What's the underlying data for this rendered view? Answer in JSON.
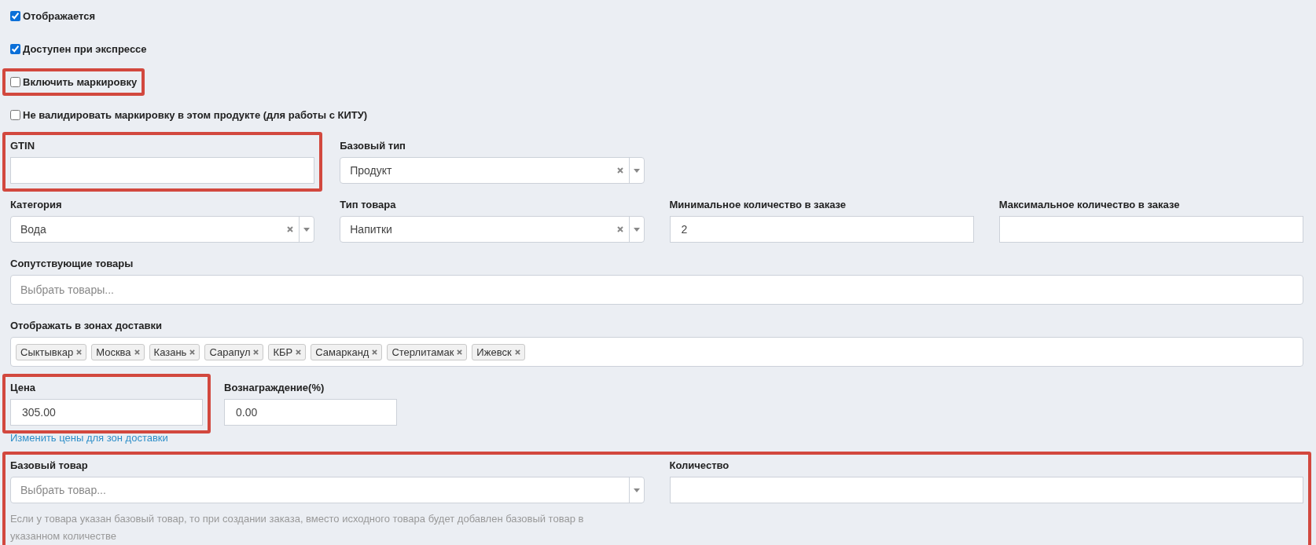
{
  "checkboxes": [
    {
      "label": "Отображается",
      "checked": true,
      "highlighted": false
    },
    {
      "label": "Доступен при экспрессе",
      "checked": true,
      "highlighted": false
    },
    {
      "label": "Включить маркировку",
      "checked": false,
      "highlighted": true
    },
    {
      "label": "Не валидировать маркировку в этом продукте (для работы с КИТУ)",
      "checked": false,
      "highlighted": false
    }
  ],
  "rows": [
    {
      "kind": "quad",
      "highlighted": false,
      "fields": [
        {
          "kind": "input",
          "label": "GTIN",
          "highlighted": true
        },
        {
          "kind": "select",
          "label": "Базовый тип",
          "value": "Продукт",
          "clearable": true,
          "highlighted": false
        }
      ]
    },
    {
      "kind": "quad",
      "highlighted": false,
      "fields": [
        {
          "kind": "select",
          "label": "Категория",
          "value": "Вода",
          "clearable": true,
          "highlighted": false
        },
        {
          "kind": "select",
          "label": "Тип товара",
          "value": "Напитки",
          "clearable": true,
          "highlighted": false
        },
        {
          "kind": "input",
          "label": "Минимальное количество в заказе",
          "value": "2",
          "highlighted": false
        },
        {
          "kind": "input",
          "label": "Максимальное количество в заказе",
          "highlighted": false
        }
      ]
    },
    {
      "kind": "wide",
      "highlighted": false,
      "fields": [
        {
          "kind": "multiselect",
          "label": "Сопутствующие товары",
          "placeholder": "Выбрать товары...",
          "highlighted": false
        }
      ]
    },
    {
      "kind": "wide",
      "highlighted": false,
      "fields": [
        {
          "kind": "tags",
          "label": "Отображать в зонах доставки",
          "tags": [
            "Сыктывкар",
            "Москва",
            "Казань",
            "Сарапул",
            "КБР",
            "Самарканд",
            "Стерлитамак",
            "Ижевск"
          ],
          "highlighted": false
        }
      ]
    },
    {
      "kind": "compact",
      "highlighted": false,
      "fields": [
        {
          "kind": "input",
          "label": "Цена",
          "value": "305.00",
          "highlighted": true,
          "link": "Изменить цены для зон доставки"
        },
        {
          "kind": "input",
          "label": "Вознаграждение(%)",
          "value": "0.00",
          "highlighted": false
        }
      ]
    },
    {
      "kind": "halves",
      "highlighted": true,
      "fields": [
        {
          "kind": "select",
          "label": "Базовый товар",
          "placeholder": "Выбрать товар...",
          "clearable": false,
          "highlighted": false,
          "help": "Если у товара указан базовый товар, то при создании заказа, вместо исходного товара будет добавлен базовый товар в указанном количестве"
        },
        {
          "kind": "input",
          "label": "Количество",
          "highlighted": false
        }
      ]
    }
  ]
}
